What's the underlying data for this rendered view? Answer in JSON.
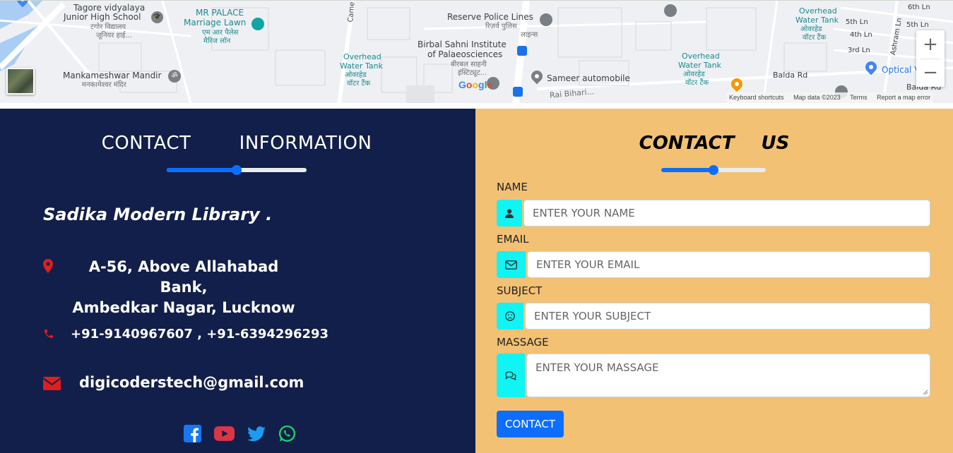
{
  "map": {
    "labels": {
      "tagore_1": "Tagore vidyalaya",
      "tagore_2": "Junior High School",
      "tagore_hi_1": "टगोर विद्यालय",
      "tagore_hi_2": "जूनियर हाई...",
      "mr_palace_1": "MR PALACE",
      "mr_palace_2": "Marriage Lawn",
      "mr_palace_hi_1": "एम आर पैलेस",
      "mr_palace_hi_2": "मैरिज लॉन",
      "mankameshwar": "Mankameshwar Mandir",
      "mankameshwar_hi": "मनकामेश्वर मंदिर",
      "reserve": "Reserve Police Lines",
      "reserve_hi_1": "रिज़र्व पुलिस",
      "reserve_hi_2": "लाइन्स",
      "birbal_1": "Birbal Sahni Institute",
      "birbal_2": "of Palaeosciences",
      "birbal_hi_1": "बीरबल साहनी",
      "birbal_hi_2": "इंस्टिट्यूट...",
      "tank1_1": "Overhead",
      "tank1_2": "Water Tank",
      "tank1_hi_1": "ओवरहेड",
      "tank1_hi_2": "वॉटर टैंक",
      "tank2_1": "Overhead",
      "tank2_2": "Water Tank",
      "tank2_hi_1": "ओवरहेड",
      "tank2_hi_2": "वॉटर टैंक",
      "tank3_1": "Overhead",
      "tank3_2": "Water Tank",
      "tank3_hi_1": "ओवरहेड",
      "tank3_hi_2": "वॉटर टैंक",
      "sameer": "Sameer automobile",
      "rai_bihari": "Rai Bihari...",
      "balda_1": "Balda Rd",
      "balda_2": "Balda Rd",
      "optical": "Optical V",
      "ln_5th": "5th Ln",
      "ln_4th": "4th Ln",
      "ln_3rd": "3rd Ln",
      "ln_6th": "6th Ln",
      "ln_5th_b": "5th Ln",
      "ashram": "Ashram Ln",
      "came": "Came"
    },
    "zoom_in": "+",
    "zoom_out": "−",
    "google_logo": "Google",
    "attribution": {
      "shortcuts": "Keyboard shortcuts",
      "map_data": "Map data ©2023",
      "terms": "Terms",
      "report": "Report a map error"
    }
  },
  "contact_info": {
    "title": "CONTACT   INFORMATION",
    "slider_value_pct": 50,
    "library_name": "Sadika Modern Library .",
    "address_line1": "A-56, Above Allahabad Bank,",
    "address_line2": "Ambedkar Nagar, Lucknow",
    "phone": "+91-9140967607 , +91-6394296293",
    "email": "digicoderstech@gmail.com",
    "social_icons": [
      "facebook-icon",
      "youtube-icon",
      "twitter-icon",
      "whatsapp-icon"
    ],
    "colors": {
      "background": "#121f4a",
      "icon_red": "#e01e1e",
      "facebook": "#1877f2",
      "youtube": "#dc3545",
      "twitter": "#1d9bf0",
      "whatsapp": "#25d366"
    }
  },
  "contact_form": {
    "title": "CONTACT  US",
    "slider_value_pct": 50,
    "name_label": "NAME",
    "name_placeholder": "ENTER YOUR NAME",
    "email_label": "EMAIL",
    "email_placeholder": "ENTER YOUR EMAIL",
    "subject_label": "SUBJECT",
    "subject_placeholder": "ENTER YOUR SUBJECT",
    "message_label": "MASSAGE",
    "message_placeholder": "ENTER YOUR MASSAGE",
    "submit_label": "CONTACT",
    "colors": {
      "background": "#f2c174",
      "addon": "#10f4f4",
      "button": "#0d6efd"
    }
  }
}
